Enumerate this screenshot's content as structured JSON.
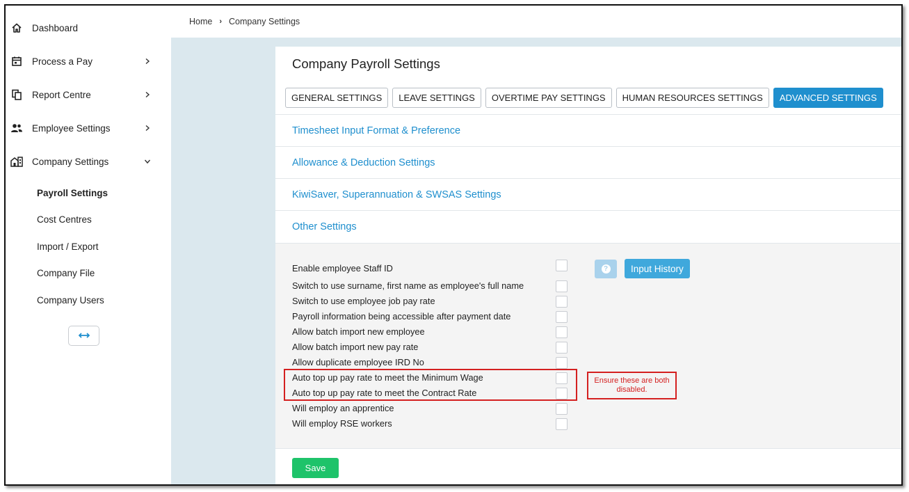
{
  "sidebar": {
    "items": [
      {
        "label": "Dashboard",
        "icon": "home-icon"
      },
      {
        "label": "Process a Pay",
        "icon": "calendar-icon"
      },
      {
        "label": "Report Centre",
        "icon": "copy-icon"
      },
      {
        "label": "Employee Settings",
        "icon": "people-icon"
      },
      {
        "label": "Company Settings",
        "icon": "building-icon"
      }
    ],
    "subitems": [
      "Payroll Settings",
      "Cost Centres",
      "Import / Export",
      "Company File",
      "Company Users"
    ],
    "collapse_icon": "↔"
  },
  "breadcrumb": {
    "home": "Home",
    "separator": "›",
    "current": "Company Settings"
  },
  "card": {
    "title": "Company Payroll Settings",
    "tabs": [
      "GENERAL SETTINGS",
      "LEAVE SETTINGS",
      "OVERTIME PAY SETTINGS",
      "HUMAN RESOURCES SETTINGS",
      "ADVANCED SETTINGS"
    ],
    "active_tab": "ADVANCED SETTINGS",
    "sections": [
      "Timesheet Input Format & Preference",
      "Allowance & Deduction Settings",
      "KiwiSaver, Superannuation & SWSAS Settings",
      "Other Settings"
    ],
    "other_settings": [
      {
        "label": "Enable employee Staff ID",
        "checked": false
      },
      {
        "label": "Switch to use surname, first name as employee's full name",
        "checked": false
      },
      {
        "label": "Switch to use employee job pay rate",
        "checked": false
      },
      {
        "label": "Payroll information being accessible after payment date",
        "checked": false
      },
      {
        "label": "Allow batch import new employee",
        "checked": false
      },
      {
        "label": "Allow batch import new pay rate",
        "checked": false
      },
      {
        "label": "Allow duplicate employee IRD No",
        "checked": false
      },
      {
        "label": "Auto top up pay rate to meet the Minimum Wage",
        "checked": false
      },
      {
        "label": "Auto top up pay rate to meet the Contract Rate",
        "checked": false
      },
      {
        "label": "Will employ an apprentice",
        "checked": false
      },
      {
        "label": "Will employ RSE workers",
        "checked": false
      }
    ],
    "help_icon": "?",
    "input_history_label": "Input History",
    "annotation": "Ensure these are both disabled.",
    "save_label": "Save"
  },
  "colors": {
    "accent": "#1f8fce",
    "save": "#1ec36a",
    "annotation": "#d42020",
    "main_bg": "#dbe8ee"
  }
}
